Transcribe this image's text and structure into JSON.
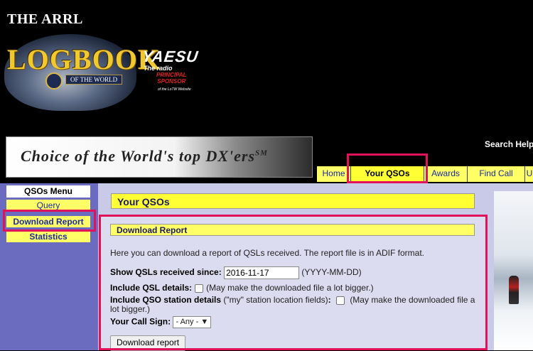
{
  "header": {
    "org": "THE ARRL",
    "logo_main": "LOGBOOK",
    "logo_sub": "OF THE WORLD",
    "sponsor": {
      "brand": "YAESU",
      "tagline": "The radio",
      "role_line1": "PRINCIPAL",
      "role_line2": "SPONSOR",
      "note": "of the LoTW Website"
    },
    "banner_text": "Choice of the World's top DX'ers",
    "banner_mark": "SM",
    "search_help": "Search Help:"
  },
  "nav": {
    "items": [
      {
        "label": "Home"
      },
      {
        "label": "Your QSOs"
      },
      {
        "label": "Awards"
      },
      {
        "label": "Find Call"
      },
      {
        "label": "U"
      }
    ],
    "active": "Your QSOs"
  },
  "sidebar": {
    "title": "QSOs Menu",
    "items": [
      {
        "label": "Query"
      },
      {
        "label": "Download Report"
      },
      {
        "label": "Statistics"
      }
    ]
  },
  "main": {
    "title": "Your QSOs",
    "section_title": "Download Report",
    "description": "Here you can download a report of QSLs received. The report file is in ADIF format.",
    "since": {
      "label": "Show QSLs received since:",
      "value": "2016-11-17",
      "hint": "(YYYY-MM-DD)"
    },
    "qsl_details": {
      "label": "Include QSL details:",
      "hint": "(May make the downloaded file a lot bigger.)",
      "checked": false
    },
    "station_details": {
      "label": "Include QSO station details",
      "paren": "(\"my\" station location fields)",
      "colon": ":",
      "hint": "(May make the downloaded file a lot bigger.)",
      "checked": false
    },
    "callsign": {
      "label": "Your Call Sign:",
      "selected": "- Any -"
    },
    "button": "Download report"
  },
  "colors": {
    "highlight": "#e0135a",
    "nav_bg": "#ffff66",
    "sidebar_bg": "#6b6bbf",
    "content_bg": "#c9c9e8"
  }
}
